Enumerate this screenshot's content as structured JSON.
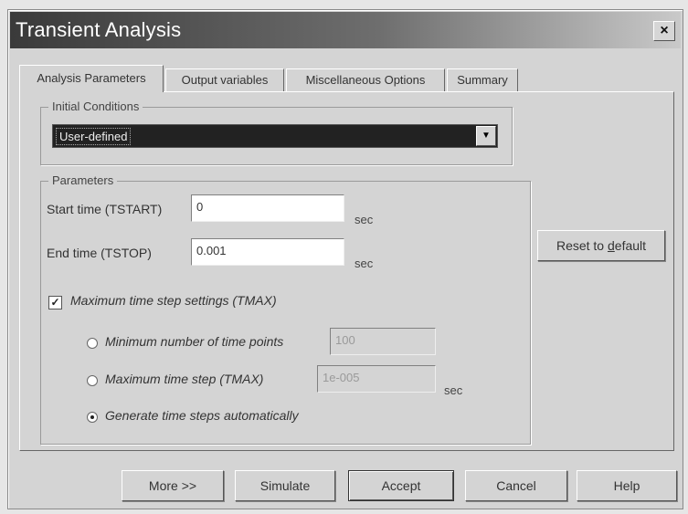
{
  "window": {
    "title": "Transient Analysis",
    "close_glyph": "×"
  },
  "tabs": [
    {
      "label": "Analysis Parameters",
      "active": true
    },
    {
      "label": "Output variables",
      "active": false
    },
    {
      "label": "Miscellaneous Options",
      "active": false
    },
    {
      "label": "Summary",
      "active": false
    }
  ],
  "initial_conditions": {
    "group_label": "Initial Conditions",
    "selected": "User-defined",
    "dropdown_icon": "down-arrow-icon"
  },
  "parameters": {
    "group_label": "Parameters",
    "start_time": {
      "label": "Start time (TSTART)",
      "value": "0",
      "unit": "sec"
    },
    "end_time": {
      "label": "End time (TSTOP)",
      "value": "0.001",
      "unit": "sec"
    },
    "tmax_checkbox": {
      "label": "Maximum time step settings (TMAX)",
      "checked": true
    },
    "radio_min_points": {
      "label": "Minimum number of time points",
      "value": "100",
      "checked": false
    },
    "radio_max_step": {
      "label": "Maximum time step (TMAX)",
      "value": "1e-005",
      "unit": "sec",
      "checked": false
    },
    "radio_auto": {
      "label": "Generate time steps automatically",
      "checked": true
    }
  },
  "reset_button": {
    "label_pre": "Reset to ",
    "label_accel": "d",
    "label_post": "efault"
  },
  "footer_buttons": {
    "more": "More >>",
    "simulate": "Simulate",
    "accept": "Accept",
    "cancel": "Cancel",
    "help": "Help"
  }
}
